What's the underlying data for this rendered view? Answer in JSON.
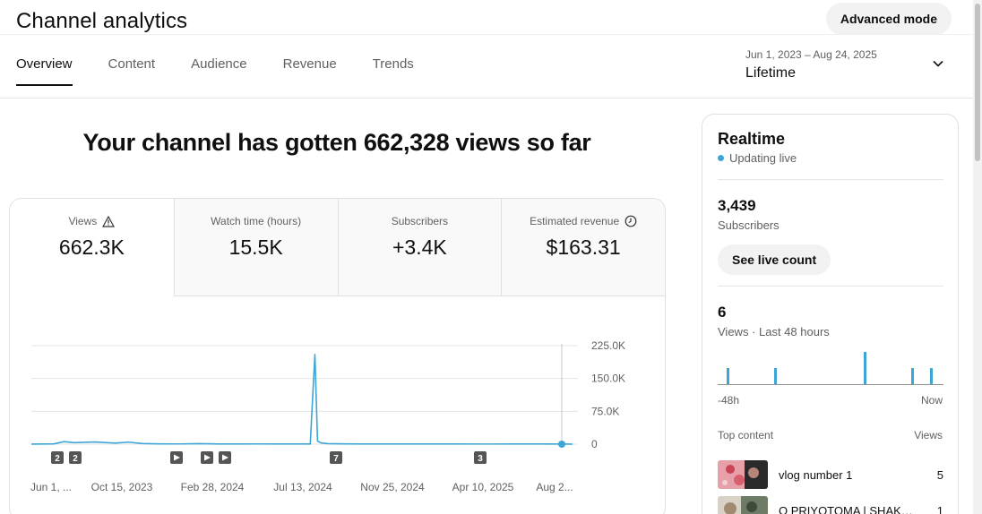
{
  "header": {
    "title": "Channel analytics",
    "advanced_mode": "Advanced mode",
    "tabs": [
      {
        "label": "Overview",
        "active": true
      },
      {
        "label": "Content",
        "active": false
      },
      {
        "label": "Audience",
        "active": false
      },
      {
        "label": "Revenue",
        "active": false
      },
      {
        "label": "Trends",
        "active": false
      }
    ],
    "date_range": "Jun 1, 2023 – Aug 24, 2025",
    "date_label": "Lifetime",
    "date_icon": "chevron-down-icon"
  },
  "headline": "Your channel has gotten 662,328 views so far",
  "metrics": [
    {
      "label": "Views",
      "value": "662.3K",
      "icon": "warning-icon",
      "selected": true
    },
    {
      "label": "Watch time (hours)",
      "value": "15.5K",
      "selected": false
    },
    {
      "label": "Subscribers",
      "value": "+3.4K",
      "selected": false
    },
    {
      "label": "Estimated revenue",
      "value": "$163.31",
      "icon": "clock-icon",
      "selected": false
    }
  ],
  "chart_data": {
    "type": "line",
    "series": [
      {
        "name": "Views",
        "color": "#3ea6d6"
      }
    ],
    "x": [
      "2023-06-01",
      "2023-06-20",
      "2023-07-05",
      "2023-07-20",
      "2023-08-05",
      "2023-08-20",
      "2023-09-05",
      "2023-09-20",
      "2023-10-05",
      "2023-10-25",
      "2023-11-15",
      "2023-12-10",
      "2024-01-10",
      "2024-02-10",
      "2024-03-10",
      "2024-04-10",
      "2024-05-10",
      "2024-06-10",
      "2024-07-01",
      "2024-07-25",
      "2024-08-01",
      "2024-08-05",
      "2024-08-10",
      "2024-08-20",
      "2024-09-15",
      "2024-10-20",
      "2024-12-01",
      "2025-01-15",
      "2025-03-01",
      "2025-04-15",
      "2025-06-01",
      "2025-07-15",
      "2025-08-24"
    ],
    "y": [
      200,
      400,
      600,
      5800,
      3500,
      4200,
      5000,
      3800,
      2500,
      4600,
      1500,
      600,
      500,
      1100,
      400,
      300,
      500,
      400,
      300,
      400,
      205000,
      7000,
      3000,
      1200,
      600,
      400,
      300,
      400,
      300,
      250,
      300,
      350,
      0
    ],
    "ylim": [
      0,
      225000
    ],
    "yticks": [
      "225.0K",
      "150.0K",
      "75.0K",
      "0"
    ],
    "xticks": [
      "Jun 1, ...",
      "Oct 15, 2023",
      "Feb 28, 2024",
      "Jul 13, 2024",
      "Nov 25, 2024",
      "Apr 10, 2025",
      "Aug 2..."
    ],
    "markers": [
      "2",
      "2",
      "▶",
      "▶",
      "▶",
      "7",
      "3"
    ],
    "grid": true
  },
  "realtime": {
    "title": "Realtime",
    "live_text": "Updating live",
    "subscribers_value": "3,439",
    "subscribers_label": "Subscribers",
    "live_count_button": "See live count",
    "views_value": "6",
    "views_label": "Views · Last 48 hours",
    "bars": [
      1,
      1,
      2,
      1,
      1
    ],
    "axis_start": "-48h",
    "axis_end": "Now",
    "top_content_label": "Top content",
    "views_col_label": "Views",
    "top_content": [
      {
        "title": "vlog number 1",
        "views": "5"
      },
      {
        "title": "O PRIYOTOMA | SHAKIB...",
        "views": "1"
      }
    ]
  }
}
